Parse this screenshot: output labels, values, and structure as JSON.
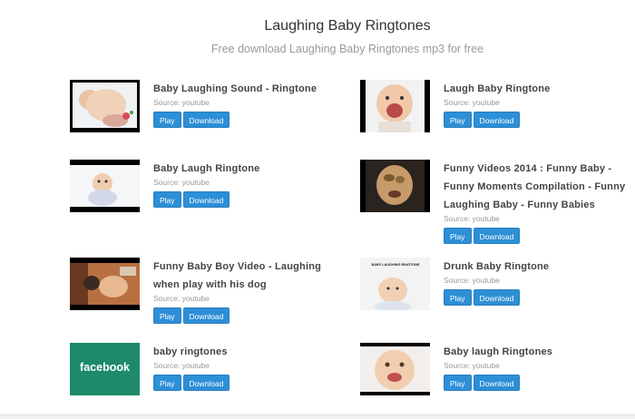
{
  "page": {
    "title": "Laughing Baby Ringtones",
    "subtitle": "Free download Laughing Baby Ringtones mp3 for free"
  },
  "items": [
    {
      "title": "Baby Laughing Sound - Ringtone",
      "source": "Source: youtube",
      "play_label": "Play",
      "download_label": "Download"
    },
    {
      "title": "Laugh Baby Ringtone",
      "source": "Source: youtube",
      "play_label": "Play",
      "download_label": "Download"
    },
    {
      "title": "Baby Laugh Ringtone",
      "source": "Source: youtube",
      "play_label": "Play",
      "download_label": "Download"
    },
    {
      "title": "Funny Videos 2014 : Funny Baby - Funny Moments Compilation - Funny Laughing Baby - Funny Babies",
      "source": "Source: youtube",
      "play_label": "Play",
      "download_label": "Download"
    },
    {
      "title": "Funny Baby Boy Video - Laughing when play with his dog",
      "source": "Source: youtube",
      "play_label": "Play",
      "download_label": "Download"
    },
    {
      "title": "Drunk Baby Ringtone",
      "source": "Source: youtube",
      "play_label": "Play",
      "download_label": "Download",
      "thumb_text": "BABY LAUGHING RINGTONE"
    },
    {
      "title": "baby ringtones",
      "source": "Source: youtube",
      "play_label": "Play",
      "download_label": "Download",
      "thumb_text": "facebook"
    },
    {
      "title": "Baby laugh Ringtones",
      "source": "Source: youtube",
      "play_label": "Play",
      "download_label": "Download"
    }
  ],
  "colors": {
    "button_blue": "#2d8fd6",
    "facebook_green": "#1d8a6a"
  }
}
